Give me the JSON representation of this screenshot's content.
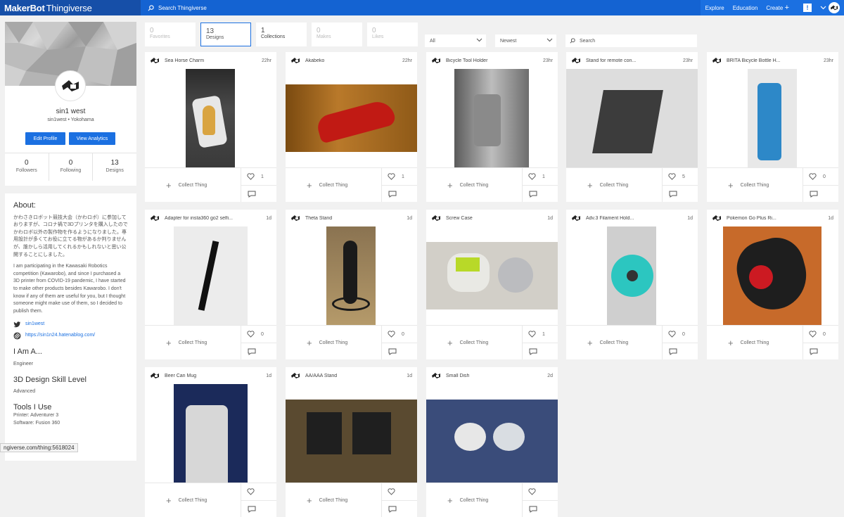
{
  "header": {
    "logo_brand": "MakerBot",
    "logo_product": "Thingiverse",
    "search_placeholder": "Search Thingiverse",
    "nav": [
      "Explore",
      "Education",
      "Create"
    ],
    "notification": "!"
  },
  "profile": {
    "name": "sin1 west",
    "location": "sin1west • Yokohama",
    "edit_button": "Edit Profile",
    "analytics_button": "View Analytics",
    "stats": [
      {
        "value": "0",
        "label": "Followers"
      },
      {
        "value": "0",
        "label": "Following"
      },
      {
        "value": "13",
        "label": "Designs"
      }
    ]
  },
  "about": {
    "heading": "About:",
    "text_jp": "かわさきロボット競技大会（かわロボ）に参加しておりますが、コロナ禍で3Dプリンタを購入したのでかわロボ以外の製作物を作るようになりました。専用設計が多くてお役に立てる物があるか判りませんが、誰かしら活用してくれるかもしれないと思い公開することにしました。",
    "text_en": "I am participating in the Kawasaki Robotics competition (Kawarobo), and since I purchased a 3D printer from COVID-19 pandemic, I have started to make other products besides Kawarobo. I don't know if any of them are useful for you, but I thought someone might make use of them, so I decided to publish them.",
    "twitter": "sin1west",
    "website": "https://sin1n24.hatenablog.com/",
    "iam_heading": "I Am A...",
    "iam_value": "Engineer",
    "skill_heading": "3D Design Skill Level",
    "skill_value": "Advanced",
    "tools_heading": "Tools I Use",
    "printer": "Printer: Adventurer 3",
    "software": "Software: Fusion 360"
  },
  "tabs": [
    {
      "count": "0",
      "label": "Favorites"
    },
    {
      "count": "13",
      "label": "Designs"
    },
    {
      "count": "1",
      "label": "Collections"
    },
    {
      "count": "0",
      "label": "Makes"
    },
    {
      "count": "0",
      "label": "Likes"
    }
  ],
  "filters": {
    "type": "All",
    "sort": "Newest",
    "search_placeholder": "Search"
  },
  "collect_label": "Collect Thing",
  "things": [
    {
      "title": "Sea Horse Charm",
      "time": "22hr",
      "likes": "1"
    },
    {
      "title": "Akabeko",
      "time": "22hr",
      "likes": "1"
    },
    {
      "title": "Bicycle Tool Holder",
      "time": "23hr",
      "likes": "1"
    },
    {
      "title": "Stand for remote con...",
      "time": "23hr",
      "likes": "5"
    },
    {
      "title": "BRITA Bicycle Bottle H...",
      "time": "23hr",
      "likes": "0"
    },
    {
      "title": "Adapter for insta360 go2 selfi...",
      "time": "1d",
      "likes": "0"
    },
    {
      "title": "Theta Stand",
      "time": "1d",
      "likes": "0"
    },
    {
      "title": "Screw Case",
      "time": "1d",
      "likes": "1"
    },
    {
      "title": "Adv.3 Filament Hold...",
      "time": "1d",
      "likes": "0"
    },
    {
      "title": "Pokemon Go Plus Ri...",
      "time": "1d",
      "likes": "0"
    },
    {
      "title": "Beer Can Mug",
      "time": "1d",
      "likes": ""
    },
    {
      "title": "AA/AAA Stand",
      "time": "1d",
      "likes": ""
    },
    {
      "title": "Small Dish",
      "time": "2d",
      "likes": ""
    }
  ],
  "status_url": "ngiverse.com/thing:5618024"
}
